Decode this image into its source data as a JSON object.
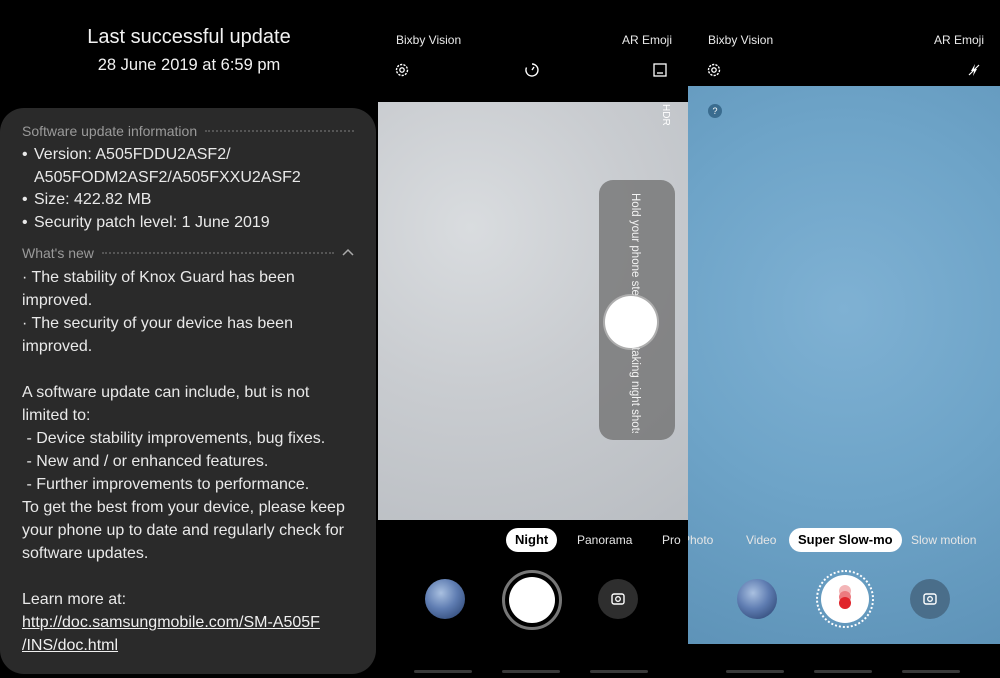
{
  "update": {
    "title": "Last successful update",
    "date": "28 June 2019 at 6:59 pm",
    "info_heading": "Software update information",
    "info_items": [
      "Version: A505FDDU2ASF2/",
      "A505FODM2ASF2/A505FXXU2ASF2",
      "Size: 422.82 MB",
      "Security patch level: 1 June 2019"
    ],
    "whats_new_heading": "What's new",
    "whats_new_lines": [
      "· The stability of Knox Guard has been",
      "improved.",
      "· The security of your device has been",
      "improved."
    ],
    "body_lines": [
      "A software update can include, but is not",
      "limited to:",
      " - Device stability improvements, bug fixes.",
      " - New and / or enhanced features.",
      " - Further improvements to performance.",
      "To get the best from your device, please keep",
      "your phone up to date and regularly check for",
      "software updates."
    ],
    "learn_more": "Learn more at:",
    "link_line1": "http://doc.samsungmobile.com/SM-A505F",
    "link_line2": "/INS/doc.html"
  },
  "camera_night": {
    "bixby_label": "Bixby Vision",
    "ar_label": "AR Emoji",
    "hdr_label": "HDR",
    "hint": "Hold your phone steady while taking night shots.",
    "modes": [
      "Night",
      "Panorama",
      "Pro"
    ],
    "selected_mode": "Night",
    "icons": [
      "settings-icon",
      "timer-icon",
      "aspect-ratio-icon",
      "switch-camera-icon"
    ]
  },
  "camera_slow": {
    "bixby_label": "Bixby Vision",
    "ar_label": "AR Emoji",
    "help_badge": "?",
    "modes": [
      "Photo",
      "Video",
      "Super Slow-mo",
      "Slow motion"
    ],
    "selected_mode": "Super Slow-mo",
    "icons": [
      "settings-icon",
      "flash-off-icon",
      "record-icon",
      "switch-camera-icon"
    ]
  },
  "colors": {
    "card_bg": "#2a2a2a",
    "record_red": "#e0242b",
    "sky": "#6ea4c8"
  }
}
